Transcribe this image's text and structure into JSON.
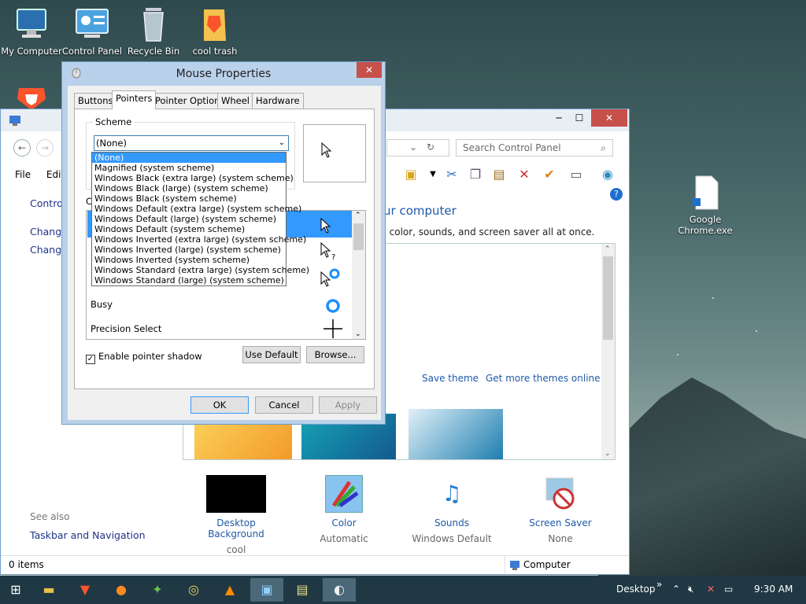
{
  "desktop": {
    "icons": [
      {
        "label": "My Computer"
      },
      {
        "label": "Control Panel"
      },
      {
        "label": "Recycle Bin"
      },
      {
        "label": "cool trash"
      },
      {
        "label": "Google Chrome.exe"
      }
    ]
  },
  "control_panel": {
    "search_placeholder": "Search Control Panel",
    "menu": [
      "File",
      "Edit"
    ],
    "left_links": [
      "Control",
      "Change",
      "Change"
    ],
    "heading": "ur computer",
    "subheading": ", color, sounds, and screen saver all at once.",
    "save_theme": "Save theme",
    "get_more": "Get more themes online",
    "see_also_title": "See also",
    "see_also_link": "Taskbar and Navigation",
    "bottom": [
      {
        "label": "Desktop Background",
        "value": "cool"
      },
      {
        "label": "Color",
        "value": "Automatic"
      },
      {
        "label": "Sounds",
        "value": "Windows Default"
      },
      {
        "label": "Screen Saver",
        "value": "None"
      }
    ],
    "status_items": "0 items",
    "status_computer": "Computer"
  },
  "mouse_props": {
    "title": "Mouse Properties",
    "close": "✕",
    "tabs": [
      "Buttons",
      "Pointers",
      "Pointer Options",
      "Wheel",
      "Hardware"
    ],
    "active_tab": 1,
    "scheme_label": "Scheme",
    "scheme_value": "(None)",
    "customize_label": "C",
    "pointer_rows": [
      {
        "label": "",
        "selected": true
      },
      {
        "label": ""
      },
      {
        "label": ""
      },
      {
        "label": "Busy"
      },
      {
        "label": "Precision Select"
      }
    ],
    "enable_shadow": "Enable pointer shadow",
    "use_default": "Use Default",
    "browse": "Browse...",
    "ok": "OK",
    "cancel": "Cancel",
    "apply": "Apply",
    "dropdown_options": [
      "(None)",
      "Magnified (system scheme)",
      "Windows Black (extra large) (system scheme)",
      "Windows Black (large) (system scheme)",
      "Windows Black (system scheme)",
      "Windows Default (extra large) (system scheme)",
      "Windows Default (large) (system scheme)",
      "Windows Default (system scheme)",
      "Windows Inverted (extra large) (system scheme)",
      "Windows Inverted (large) (system scheme)",
      "Windows Inverted (system scheme)",
      "Windows Standard (extra large) (system scheme)",
      "Windows Standard (large) (system scheme)"
    ]
  },
  "taskbar": {
    "desktop_label": "Desktop",
    "time": "9:30 AM"
  },
  "colors": {
    "accent": "#3399ff",
    "link": "#1e5aa8",
    "close_red": "#c7504a",
    "taskbar": "#203844"
  }
}
